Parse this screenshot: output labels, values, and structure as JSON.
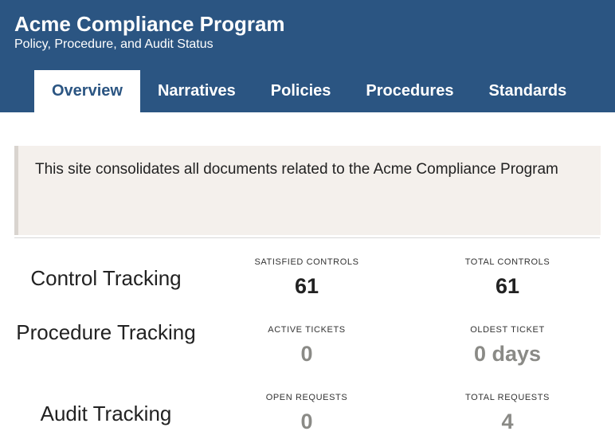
{
  "header": {
    "title": "Acme Compliance Program",
    "subtitle": "Policy, Procedure, and Audit Status",
    "background_color": "#2b5582"
  },
  "tabs": [
    {
      "label": "Overview",
      "active": true
    },
    {
      "label": "Narratives",
      "active": false
    },
    {
      "label": "Policies",
      "active": false
    },
    {
      "label": "Procedures",
      "active": false
    },
    {
      "label": "Standards",
      "active": false
    }
  ],
  "notice": {
    "text": "This site consolidates all documents related to the Acme Compliance Program"
  },
  "tracking": {
    "control": {
      "label": "Control Tracking",
      "satisfied_label": "SATISFIED CONTROLS",
      "satisfied_value": "61",
      "total_label": "TOTAL CONTROLS",
      "total_value": "61"
    },
    "procedure": {
      "label": "Procedure Tracking",
      "active_label": "ACTIVE TICKETS",
      "active_value": "0",
      "oldest_label": "OLDEST TICKET",
      "oldest_value": "0 days"
    },
    "audit": {
      "label": "Audit Tracking",
      "open_label": "OPEN REQUESTS",
      "open_value": "0",
      "total_label": "TOTAL REQUESTS",
      "total_value": "4"
    }
  }
}
